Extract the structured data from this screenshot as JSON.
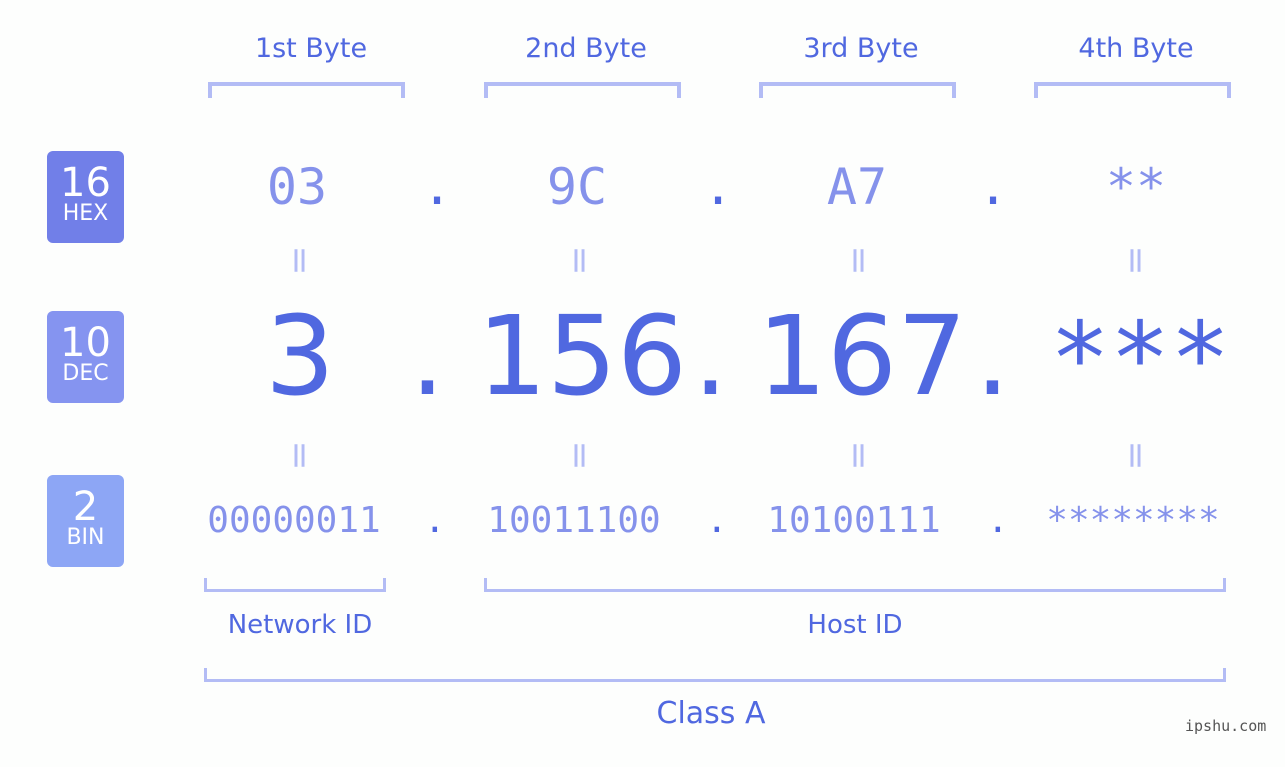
{
  "bytes": {
    "labels": [
      "1st Byte",
      "2nd Byte",
      "3rd Byte",
      "4th Byte"
    ]
  },
  "badges": [
    {
      "num": "16",
      "label": "HEX",
      "color": "#717fe8"
    },
    {
      "num": "10",
      "label": "DEC",
      "color": "#8594f0"
    },
    {
      "num": "2",
      "label": "BIN",
      "color": "#8da6f5"
    }
  ],
  "hex": [
    "03",
    "9C",
    "A7",
    "**"
  ],
  "dec": [
    "3",
    "156",
    "167",
    "***"
  ],
  "bin": [
    "00000011",
    "10011100",
    "10100111",
    "********"
  ],
  "separator": ".",
  "equals": "=",
  "ids": {
    "network": "Network ID",
    "host": "Host ID",
    "class": "Class A"
  },
  "footer": "ipshu.com"
}
